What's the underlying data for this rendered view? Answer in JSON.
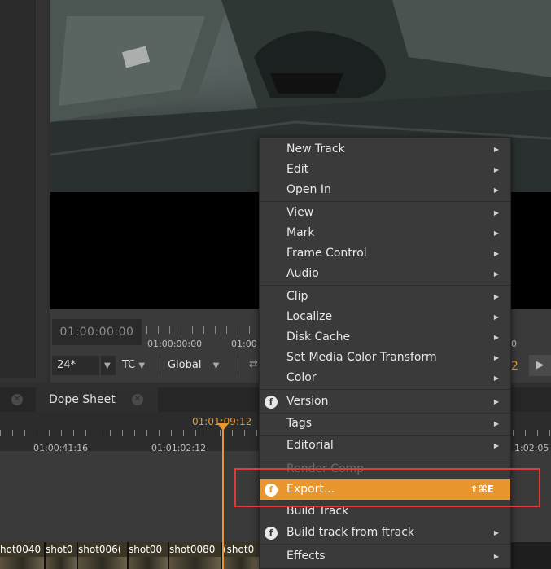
{
  "viewer": {
    "timecode": "01:00:00:00",
    "ruler_tc_1": "01:00:00:00",
    "ruler_tc_2": "01:00",
    "ruler_right": "0",
    "fps": "24*",
    "tc_mode": "TC",
    "scope": "Global",
    "frame_right": "2"
  },
  "tabs": {
    "dope_sheet": "Dope Sheet"
  },
  "timeline": {
    "current_tc": "01:01:09:12",
    "tc_a": "01:00:41:16",
    "tc_b": "01:01:02:12",
    "tc_c": "1:02:05"
  },
  "clips": [
    "hot0040",
    "shot0",
    "shot006(",
    "shot00",
    "shot0080",
    "(shot0"
  ],
  "menu": {
    "items": [
      {
        "label": "New Track",
        "submenu": true
      },
      {
        "label": "Edit",
        "submenu": true
      },
      {
        "label": "Open In",
        "submenu": true
      },
      {
        "label": "View",
        "submenu": true
      },
      {
        "label": "Mark",
        "submenu": true
      },
      {
        "label": "Frame Control",
        "submenu": true
      },
      {
        "label": "Audio",
        "submenu": true
      },
      {
        "label": "Clip",
        "submenu": true
      },
      {
        "label": "Localize",
        "submenu": true
      },
      {
        "label": "Disk Cache",
        "submenu": true
      },
      {
        "label": "Set Media Color Transform",
        "submenu": true
      },
      {
        "label": "Color",
        "submenu": true
      },
      {
        "label": "Version",
        "submenu": true,
        "icon": "ftrack-icon"
      },
      {
        "label": "Tags",
        "submenu": true
      },
      {
        "label": "Editorial",
        "submenu": true
      },
      {
        "label": "Render Comp",
        "disabled": true
      },
      {
        "label": "Export...",
        "shortcut": "⇧⌘E",
        "icon": "ftrack-icon",
        "highlighted": true
      },
      {
        "label": "Build Track",
        "submenu": false
      },
      {
        "label": "Build track from ftrack",
        "submenu": true,
        "icon": "ftrack-icon"
      },
      {
        "label": "Effects",
        "submenu": true
      }
    ]
  },
  "colors": {
    "accent": "#e8972f",
    "annotation": "#e23a3a"
  }
}
